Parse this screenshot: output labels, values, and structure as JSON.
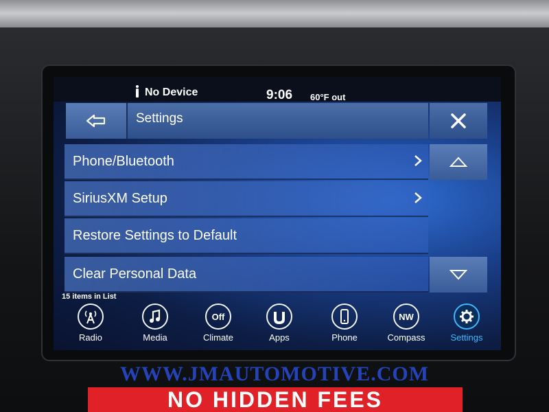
{
  "status_bar": {
    "device_text": "No Device",
    "clock": "9:06",
    "temperature": "60°F out"
  },
  "header": {
    "title": "Settings",
    "back_icon": "arrow-left-icon",
    "close_icon": "close-icon"
  },
  "list": {
    "items": [
      {
        "label": "Phone/Bluetooth",
        "has_chevron": true
      },
      {
        "label": "SiriusXM Setup",
        "has_chevron": true
      },
      {
        "label": "Restore Settings to Default",
        "has_chevron": false
      },
      {
        "label": "Clear Personal Data",
        "has_chevron": false
      }
    ],
    "count_text": "15 items in List"
  },
  "dock": {
    "items": [
      {
        "label": "Radio",
        "icon": "radio-tower-icon"
      },
      {
        "label": "Media",
        "icon": "music-note-icon"
      },
      {
        "label": "Climate",
        "icon": "climate-off-icon",
        "glyph": "Off"
      },
      {
        "label": "Apps",
        "icon": "apps-icon"
      },
      {
        "label": "Phone",
        "icon": "phone-icon"
      },
      {
        "label": "Compass",
        "icon": "compass-icon",
        "glyph": "NW"
      },
      {
        "label": "Settings",
        "icon": "gear-icon",
        "active": true
      }
    ]
  },
  "overlay": {
    "watermark": "WWW.JMAUTOMOTIVE.COM",
    "banner": "NO HIDDEN FEES"
  },
  "colors": {
    "accent_active": "#3fb8ff",
    "banner_red": "#e02127",
    "watermark_blue": "#2543b8"
  }
}
